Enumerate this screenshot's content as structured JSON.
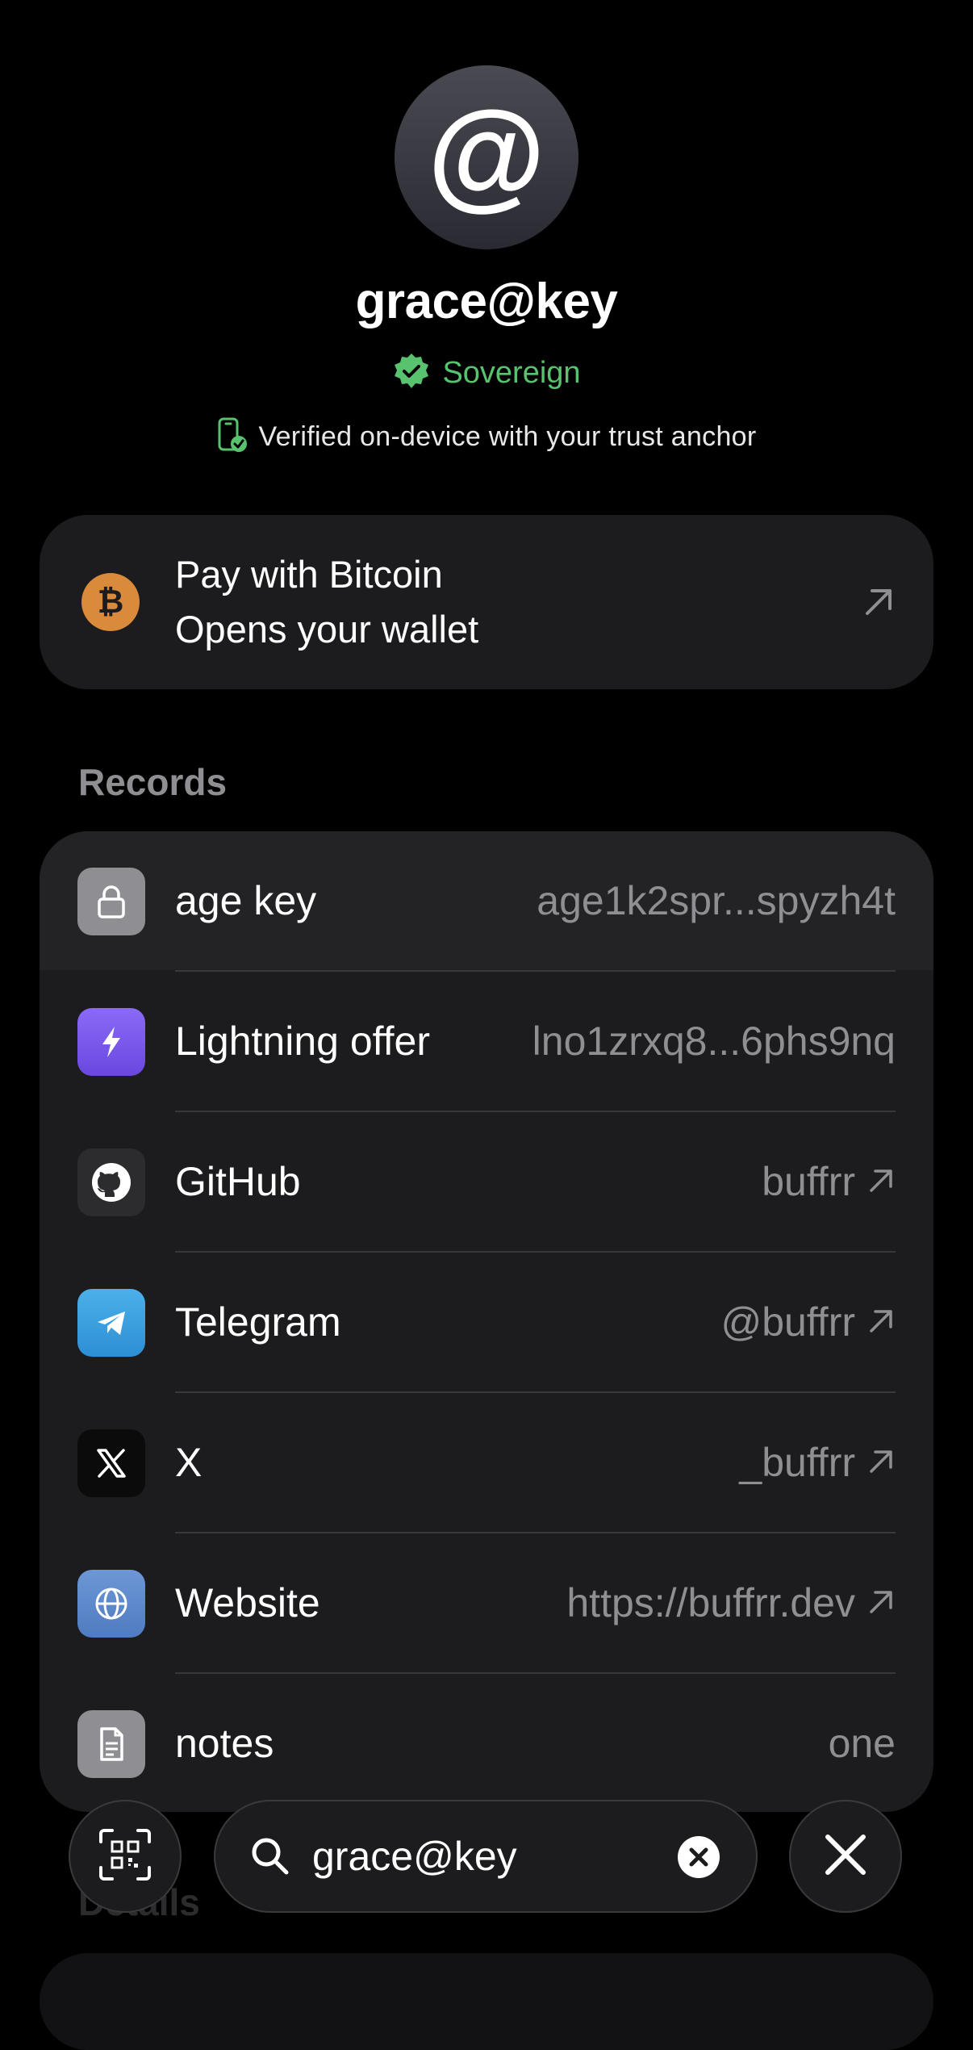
{
  "profile": {
    "avatar_icon": "at-sign-icon",
    "avatar_glyph": "@",
    "name": "grace@key",
    "badge": {
      "icon": "verified-seal-icon",
      "label": "Sovereign",
      "color": "#58c26e"
    },
    "verification": {
      "icon": "phone-check-icon",
      "text": "Verified on-device with your trust anchor"
    }
  },
  "pay": {
    "icon": "bitcoin-icon",
    "icon_glyph": "₿",
    "title": "Pay with Bitcoin",
    "subtitle": "Opens your wallet",
    "action_icon": "arrow-up-right-icon"
  },
  "records": {
    "section_label": "Records",
    "items": [
      {
        "label": "age key",
        "value": "age1k2spr...spyzh4t",
        "icon": "lock-icon",
        "tile_color": "#8e8e93",
        "external": false
      },
      {
        "label": "Lightning offer",
        "value": "lno1zrxq8...6phs9nq",
        "icon": "lightning-bolt-icon",
        "tile_color": "#7b5bf0",
        "external": false
      },
      {
        "label": "GitHub",
        "value": "buffrr",
        "icon": "github-icon",
        "tile_color": "#2c2c2e",
        "external": true
      },
      {
        "label": "Telegram",
        "value": "@buffrr",
        "icon": "telegram-icon",
        "tile_color": "#3b9ee0",
        "external": true
      },
      {
        "label": "X",
        "value": "_buffrr",
        "icon": "x-logo-icon",
        "tile_color": "#0b0b0c",
        "external": true
      },
      {
        "label": "Website",
        "value": "https://buffrr.dev",
        "icon": "globe-icon",
        "tile_color": "#5b88c9",
        "external": true
      },
      {
        "label": "notes",
        "value": "one",
        "icon": "document-icon",
        "tile_color": "#8e8e93",
        "external": false
      }
    ]
  },
  "details": {
    "section_label": "Details"
  },
  "toolbar": {
    "scan_icon": "qr-scan-icon",
    "search_icon": "search-icon",
    "search_value": "grace@key",
    "clear_icon": "clear-circle-icon",
    "close_icon": "close-icon"
  }
}
